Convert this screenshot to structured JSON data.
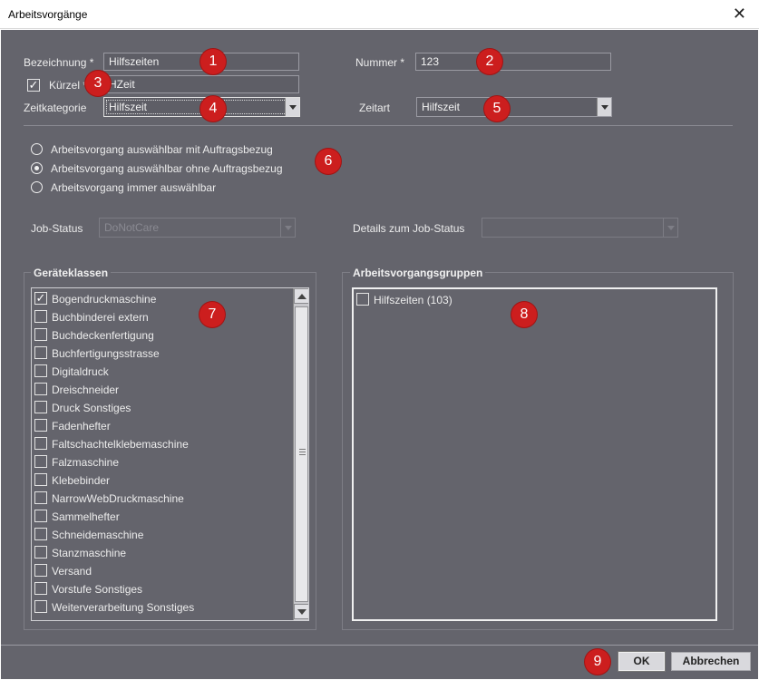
{
  "window": {
    "title": "Arbeitsvorgänge",
    "close_glyph": "✕"
  },
  "form": {
    "bezeichnung_label": "Bezeichnung *",
    "bezeichnung_value": "Hilfszeiten",
    "nummer_label": "Nummer *",
    "nummer_value": "123",
    "kuerzel_label": "Kürzel *",
    "kuerzel_value": "HZeit",
    "kuerzel_checked": true,
    "zeitkategorie_label": "Zeitkategorie",
    "zeitkategorie_value": "Hilfszeit",
    "zeitart_label": "Zeitart",
    "zeitart_value": "Hilfszeit"
  },
  "radios": [
    {
      "label": "Arbeitsvorgang auswählbar mit Auftragsbezug",
      "selected": false
    },
    {
      "label": "Arbeitsvorgang auswählbar ohne Auftragsbezug",
      "selected": true
    },
    {
      "label": "Arbeitsvorgang immer auswählbar",
      "selected": false
    }
  ],
  "job_status": {
    "label": "Job-Status",
    "value": "DoNotCare",
    "details_label": "Details zum Job-Status",
    "details_value": ""
  },
  "geraeteklassen": {
    "title": "Geräteklassen",
    "items": [
      {
        "label": "Bogendruckmaschine",
        "checked": true
      },
      {
        "label": "Buchbinderei extern",
        "checked": false
      },
      {
        "label": "Buchdeckenfertigung",
        "checked": false
      },
      {
        "label": "Buchfertigungsstrasse",
        "checked": false
      },
      {
        "label": "Digitaldruck",
        "checked": false
      },
      {
        "label": "Dreischneider",
        "checked": false
      },
      {
        "label": "Druck Sonstiges",
        "checked": false
      },
      {
        "label": "Fadenhefter",
        "checked": false
      },
      {
        "label": "Faltschachtelklebemaschine",
        "checked": false
      },
      {
        "label": "Falzmaschine",
        "checked": false
      },
      {
        "label": "Klebebinder",
        "checked": false
      },
      {
        "label": "NarrowWebDruckmaschine",
        "checked": false
      },
      {
        "label": "Sammelhefter",
        "checked": false
      },
      {
        "label": "Schneidemaschine",
        "checked": false
      },
      {
        "label": "Stanzmaschine",
        "checked": false
      },
      {
        "label": "Versand",
        "checked": false
      },
      {
        "label": "Vorstufe Sonstiges",
        "checked": false
      },
      {
        "label": "Weiterverarbeitung Sonstiges",
        "checked": false
      }
    ]
  },
  "gruppen": {
    "title": "Arbeitsvorgangsgruppen",
    "items": [
      {
        "label": "Hilfszeiten (103)",
        "checked": false
      }
    ]
  },
  "buttons": {
    "ok": "OK",
    "cancel": "Abbrechen"
  },
  "badges": [
    "1",
    "2",
    "3",
    "4",
    "5",
    "6",
    "7",
    "8",
    "9"
  ],
  "colors": {
    "background": "#64646c",
    "badge": "#cc1e1e",
    "button": "#d9d9dd"
  }
}
